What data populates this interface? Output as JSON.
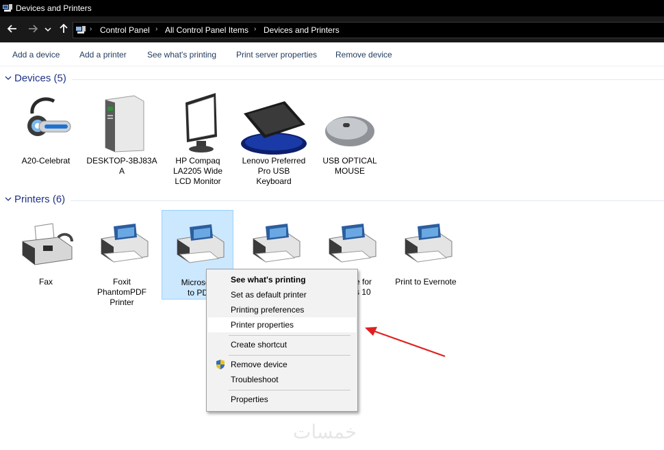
{
  "window": {
    "title": "Devices and Printers"
  },
  "address": {
    "crumbs": [
      "Control Panel",
      "All Control Panel Items",
      "Devices and Printers"
    ]
  },
  "commands": [
    "Add a device",
    "Add a printer",
    "See what's printing",
    "Print server properties",
    "Remove device"
  ],
  "devices": {
    "title": "Devices (5)",
    "items": [
      {
        "label": "A20-Celebrat",
        "icon": "headset-icon"
      },
      {
        "label": "DESKTOP-3BJ83A\nA",
        "icon": "computer-tower-icon"
      },
      {
        "label": "HP Compaq\nLA2205 Wide\nLCD Monitor",
        "icon": "monitor-icon"
      },
      {
        "label": "Lenovo Preferred\nPro USB\nKeyboard",
        "icon": "keyboard-icon"
      },
      {
        "label": "USB OPTICAL\nMOUSE",
        "icon": "mouse-icon"
      }
    ]
  },
  "printers": {
    "title": "Printers (6)",
    "items": [
      {
        "label": "Fax",
        "icon": "fax-icon"
      },
      {
        "label": "Foxit\nPhantomPDF\nPrinter",
        "icon": "printer-icon"
      },
      {
        "label": "Microsoft\nto PD",
        "icon": "printer-icon",
        "selected": true
      },
      {
        "label": "",
        "icon": "printer-icon"
      },
      {
        "label": "e for\ns 10",
        "icon": "printer-icon"
      },
      {
        "label": "Print to Evernote",
        "icon": "printer-icon"
      }
    ]
  },
  "context_menu": {
    "items": [
      {
        "label": "See what's printing",
        "bold": true
      },
      {
        "label": "Set as default printer"
      },
      {
        "label": "Printing preferences"
      },
      {
        "label": "Printer properties",
        "hover": true
      },
      {
        "label": "Create shortcut"
      },
      {
        "label": "Remove device",
        "icon": "shield-icon"
      },
      {
        "label": "Troubleshoot"
      },
      {
        "label": "Properties"
      }
    ]
  },
  "annotation": {
    "arrow_color": "#e02020",
    "icon": "red-arrow-icon"
  },
  "watermark": "خمسات",
  "colors": {
    "titlebar": "#000000",
    "navbar": "#191919",
    "link": "#1e395b",
    "group_title": "#1e3287",
    "selection": "#cce8ff"
  }
}
